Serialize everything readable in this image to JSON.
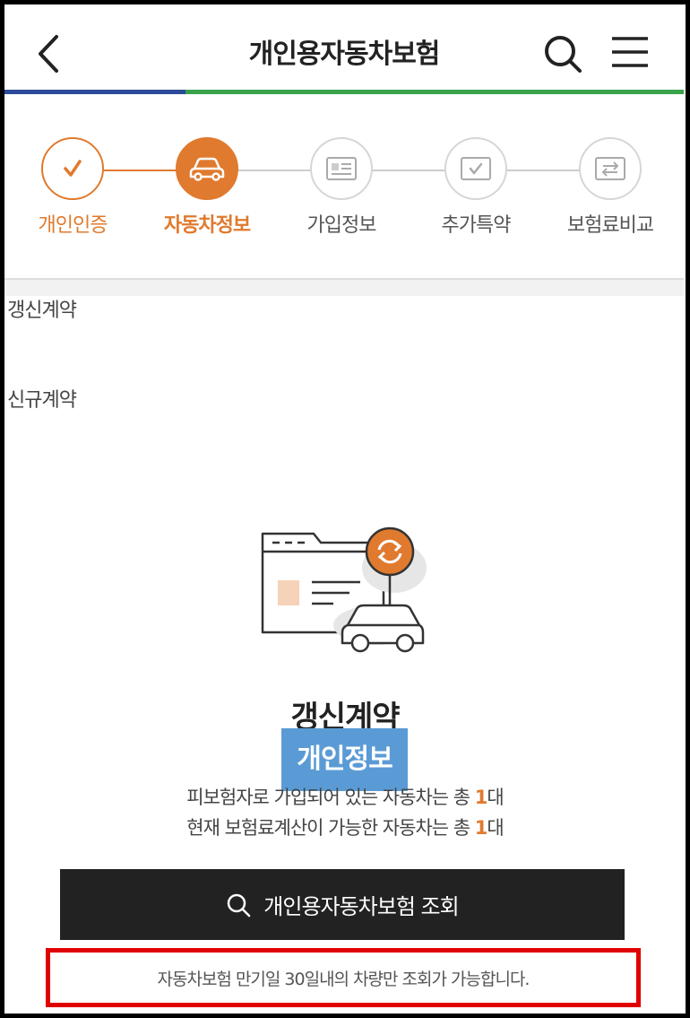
{
  "header": {
    "title": "개인용자동차보험",
    "back_icon": "chevron-left-icon",
    "search_icon": "search-icon",
    "menu_icon": "hamburger-menu-icon"
  },
  "colors": {
    "accent": "#e07a2e",
    "progress_blue": "#2d4b9a",
    "progress_green": "#3aa34a",
    "cta_bg": "#222222",
    "highlight_border": "#e00000",
    "overlay_badge": "#5b9bd5"
  },
  "steps": [
    {
      "label": "개인인증",
      "icon": "check-icon",
      "state": "done"
    },
    {
      "label": "자동차정보",
      "icon": "car-icon",
      "state": "active"
    },
    {
      "label": "가입정보",
      "icon": "id-card-icon",
      "state": "pending"
    },
    {
      "label": "추가특약",
      "icon": "checkbox-icon",
      "state": "pending"
    },
    {
      "label": "보험료비교",
      "icon": "compare-icon",
      "state": "pending"
    }
  ],
  "tabs": {
    "renew": "갱신계약",
    "new": "신규계약"
  },
  "main": {
    "illustration_icon": "renewal-car-document-icon",
    "title": "갱신계약",
    "overlay_badge": "개인정보",
    "line1_prefix": "피보험자로 가입되어 있는 자동차는 총 ",
    "line1_count": "1",
    "line1_suffix": "대",
    "line2_prefix": "현재 보험료계산이 가능한 자동차는 총 ",
    "line2_count": "1",
    "line2_suffix": "대"
  },
  "cta": {
    "label": "개인용자동차보험 조회",
    "icon": "search-icon"
  },
  "notice": "자동차보험 만기일 30일내의 차량만 조회가 가능합니다."
}
